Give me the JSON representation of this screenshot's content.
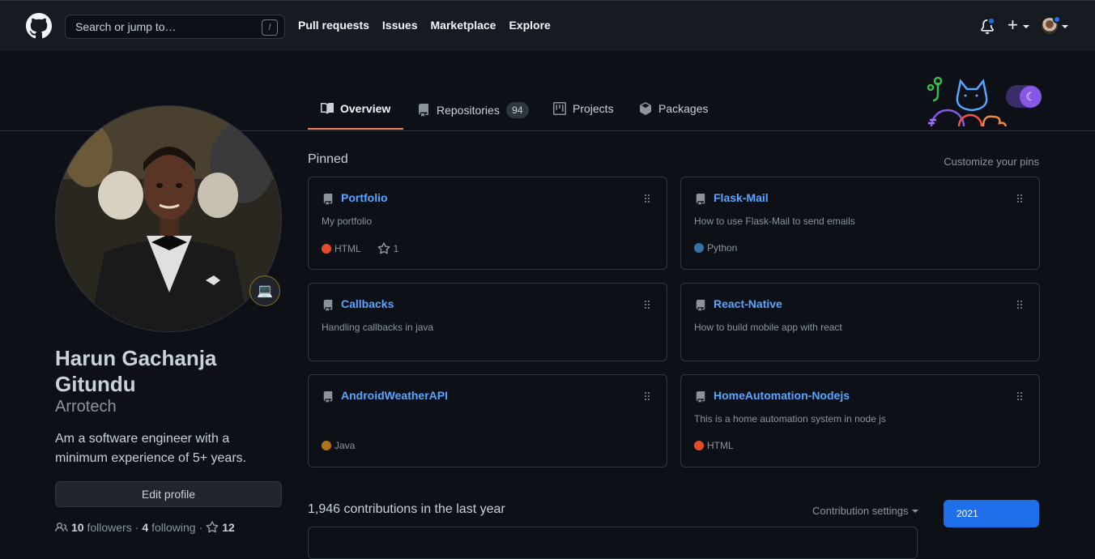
{
  "header": {
    "search_placeholder": "Search or jump to…",
    "search_shortcut": "/",
    "nav": [
      "Pull requests",
      "Issues",
      "Marketplace",
      "Explore"
    ],
    "icons": [
      "github-logo-icon",
      "bell-icon",
      "plus-icon",
      "avatar"
    ]
  },
  "tabs": [
    {
      "label": "Overview",
      "icon": "book-icon",
      "active": true
    },
    {
      "label": "Repositories",
      "icon": "repo-icon",
      "count": "94"
    },
    {
      "label": "Projects",
      "icon": "project-icon"
    },
    {
      "label": "Packages",
      "icon": "package-icon"
    }
  ],
  "profile": {
    "name": "Harun Gachanja Gitundu",
    "login": "Arrotech",
    "bio": "Am a software engineer with a minimum experience of 5+ years.",
    "edit_label": "Edit profile",
    "status_emoji": "💻",
    "followers_count": "10",
    "followers_label": "followers",
    "separator": "·",
    "following_count": "4",
    "following_label": "following",
    "stars_count": "12"
  },
  "pinned": {
    "title": "Pinned",
    "customize": "Customize your pins",
    "repos": [
      {
        "name": "Portfolio",
        "desc": "My portfolio",
        "lang": "HTML",
        "lang_color": "#e34c26",
        "stars": "1"
      },
      {
        "name": "Flask-Mail",
        "desc": "How to use Flask-Mail to send emails",
        "lang": "Python",
        "lang_color": "#3572A5"
      },
      {
        "name": "Callbacks",
        "desc": "Handling callbacks in java"
      },
      {
        "name": "React-Native",
        "desc": "How to build mobile app with react"
      },
      {
        "name": "AndroidWeatherAPI",
        "desc": "",
        "lang": "Java",
        "lang_color": "#b07219"
      },
      {
        "name": "HomeAutomation-Nodejs",
        "desc": "This is a home automation system in node js",
        "lang": "HTML",
        "lang_color": "#e34c26"
      }
    ]
  },
  "contributions": {
    "title": "1,946 contributions in the last year",
    "settings": "Contribution settings",
    "year": "2021"
  },
  "colors": {
    "accent_blue": "#58a6ff",
    "tab_underline": "#f78166",
    "year_button": "#1f6feb"
  }
}
